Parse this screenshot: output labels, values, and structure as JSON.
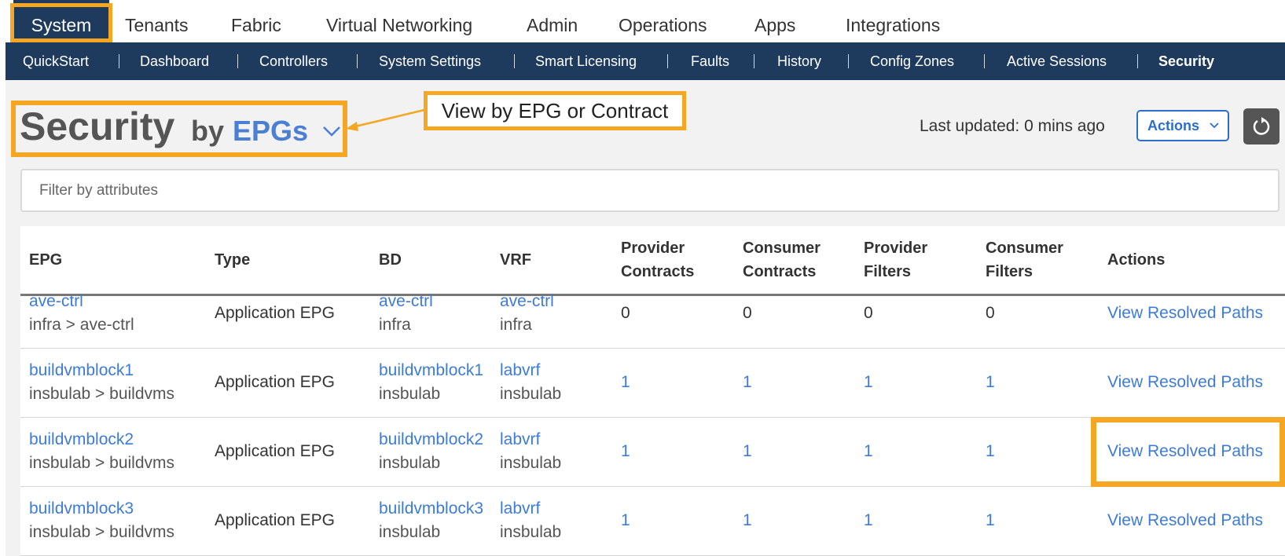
{
  "topnav": {
    "tabs": [
      "System",
      "Tenants",
      "Fabric",
      "Virtual Networking",
      "Admin",
      "Operations",
      "Apps",
      "Integrations"
    ],
    "active": "System"
  },
  "subnav": {
    "items": [
      "QuickStart",
      "Dashboard",
      "Controllers",
      "System Settings",
      "Smart Licensing",
      "Faults",
      "History",
      "Config Zones",
      "Active Sessions",
      "Security"
    ],
    "active": "Security"
  },
  "page": {
    "title": "Security",
    "by": "by",
    "view": "EPGs",
    "callout": "View by EPG or Contract",
    "last_updated": "Last updated: 0 mins ago",
    "actions_label": "Actions",
    "filter_placeholder": "Filter by attributes"
  },
  "table": {
    "headers": {
      "epg": "EPG",
      "type": "Type",
      "bd": "BD",
      "vrf": "VRF",
      "provider_contracts": [
        "Provider",
        "Contracts"
      ],
      "consumer_contracts": [
        "Consumer",
        "Contracts"
      ],
      "provider_filters": [
        "Provider",
        "Filters"
      ],
      "consumer_filters": [
        "Consumer",
        "Filters"
      ],
      "actions": "Actions"
    },
    "rows": [
      {
        "epg": "ave-ctrl",
        "epg_path": "infra > ave-ctrl",
        "type": "Application EPG",
        "bd": "ave-ctrl",
        "bd_tenant": "infra",
        "vrf": "ave-ctrl",
        "vrf_tenant": "infra",
        "pc": "0",
        "cc": "0",
        "pf": "0",
        "cf": "0",
        "action": "View Resolved Paths"
      },
      {
        "epg": "buildvmblock1",
        "epg_path": "insbulab > buildvms",
        "type": "Application EPG",
        "bd": "buildvmblock1",
        "bd_tenant": "insbulab",
        "vrf": "labvrf",
        "vrf_tenant": "insbulab",
        "pc": "1",
        "cc": "1",
        "pf": "1",
        "cf": "1",
        "action": "View Resolved Paths"
      },
      {
        "epg": "buildvmblock2",
        "epg_path": "insbulab > buildvms",
        "type": "Application EPG",
        "bd": "buildvmblock2",
        "bd_tenant": "insbulab",
        "vrf": "labvrf",
        "vrf_tenant": "insbulab",
        "pc": "1",
        "cc": "1",
        "pf": "1",
        "cf": "1",
        "action": "View Resolved Paths"
      },
      {
        "epg": "buildvmblock3",
        "epg_path": "insbulab > buildvms",
        "type": "Application EPG",
        "bd": "buildvmblock3",
        "bd_tenant": "insbulab",
        "vrf": "labvrf",
        "vrf_tenant": "insbulab",
        "pc": "1",
        "cc": "1",
        "pf": "1",
        "cf": "1",
        "action": "View Resolved Paths"
      }
    ]
  },
  "colors": {
    "nav_dark": "#1e3a5c",
    "highlight": "#f5a623",
    "link": "#3d7bd6",
    "accent_button": "#2c6ecb"
  }
}
